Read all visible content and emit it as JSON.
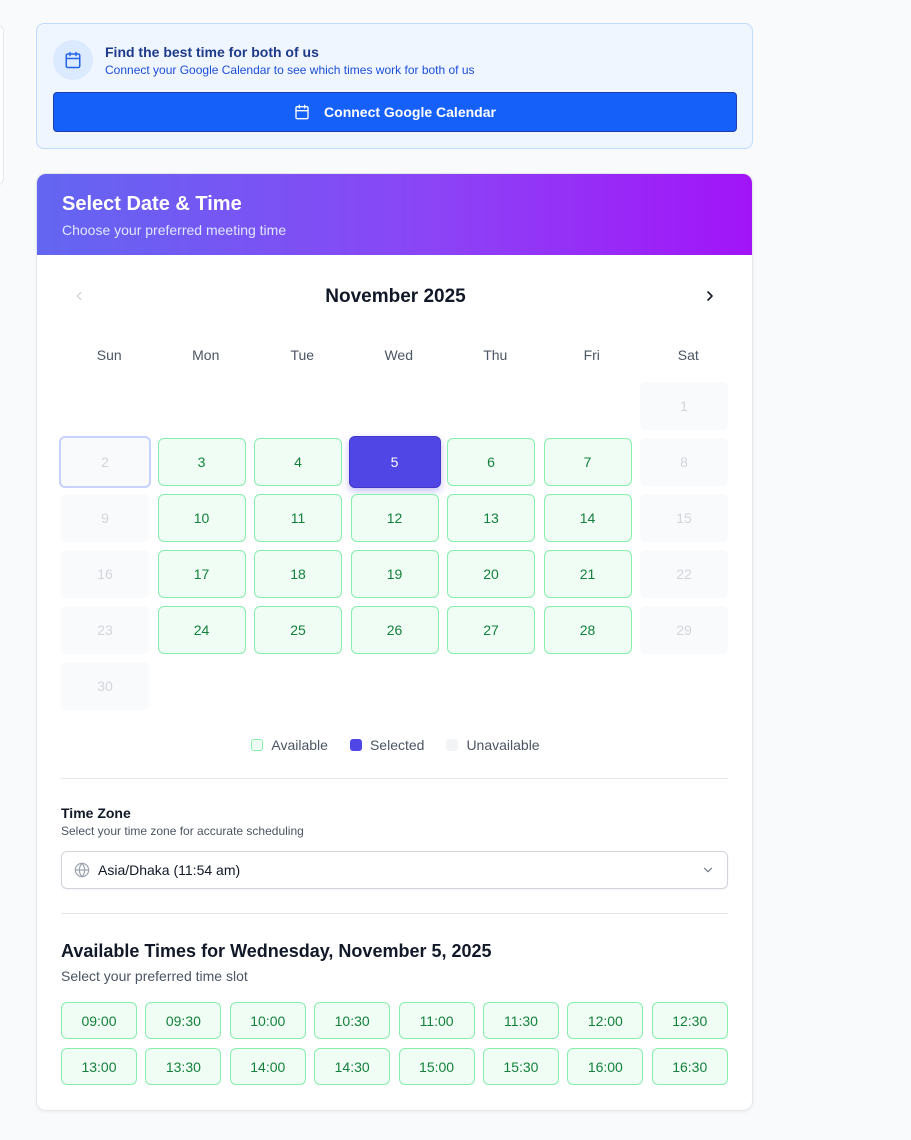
{
  "google_calendar": {
    "title": "Find the best time for both of us",
    "subtitle": "Connect your Google Calendar to see which times work for both of us",
    "button_label": "Connect Google Calendar"
  },
  "scheduler": {
    "title": "Select Date & Time",
    "subtitle": "Choose your preferred meeting time",
    "month_label": "November 2025",
    "weekdays": [
      "Sun",
      "Mon",
      "Tue",
      "Wed",
      "Thu",
      "Fri",
      "Sat"
    ],
    "first_weekday_index": 6,
    "days": [
      {
        "label": "1",
        "status": "unavailable"
      },
      {
        "label": "2",
        "status": "today"
      },
      {
        "label": "3",
        "status": "available"
      },
      {
        "label": "4",
        "status": "available"
      },
      {
        "label": "5",
        "status": "selected"
      },
      {
        "label": "6",
        "status": "available"
      },
      {
        "label": "7",
        "status": "available"
      },
      {
        "label": "8",
        "status": "unavailable"
      },
      {
        "label": "9",
        "status": "unavailable"
      },
      {
        "label": "10",
        "status": "available"
      },
      {
        "label": "11",
        "status": "available"
      },
      {
        "label": "12",
        "status": "available"
      },
      {
        "label": "13",
        "status": "available"
      },
      {
        "label": "14",
        "status": "available"
      },
      {
        "label": "15",
        "status": "unavailable"
      },
      {
        "label": "16",
        "status": "unavailable"
      },
      {
        "label": "17",
        "status": "available"
      },
      {
        "label": "18",
        "status": "available"
      },
      {
        "label": "19",
        "status": "available"
      },
      {
        "label": "20",
        "status": "available"
      },
      {
        "label": "21",
        "status": "available"
      },
      {
        "label": "22",
        "status": "unavailable"
      },
      {
        "label": "23",
        "status": "unavailable"
      },
      {
        "label": "24",
        "status": "available"
      },
      {
        "label": "25",
        "status": "available"
      },
      {
        "label": "26",
        "status": "available"
      },
      {
        "label": "27",
        "status": "available"
      },
      {
        "label": "28",
        "status": "available"
      },
      {
        "label": "29",
        "status": "unavailable"
      },
      {
        "label": "30",
        "status": "unavailable"
      }
    ],
    "legend": {
      "available": "Available",
      "selected": "Selected",
      "unavailable": "Unavailable"
    },
    "timezone": {
      "title": "Time Zone",
      "subtitle": "Select your time zone for accurate scheduling",
      "value": "Asia/Dhaka (11:54 am)"
    },
    "times": {
      "title": "Available Times for Wednesday, November 5, 2025",
      "subtitle": "Select your preferred time slot",
      "slots": [
        "09:00",
        "09:30",
        "10:00",
        "10:30",
        "11:00",
        "11:30",
        "12:00",
        "12:30",
        "13:00",
        "13:30",
        "14:00",
        "14:30",
        "15:00",
        "15:30",
        "16:00",
        "16:30"
      ]
    }
  },
  "colors": {
    "accent": "#4f46e5",
    "primary_button": "#1660fa",
    "available_bg": "#f0fdf4",
    "available_text": "#15803d"
  }
}
